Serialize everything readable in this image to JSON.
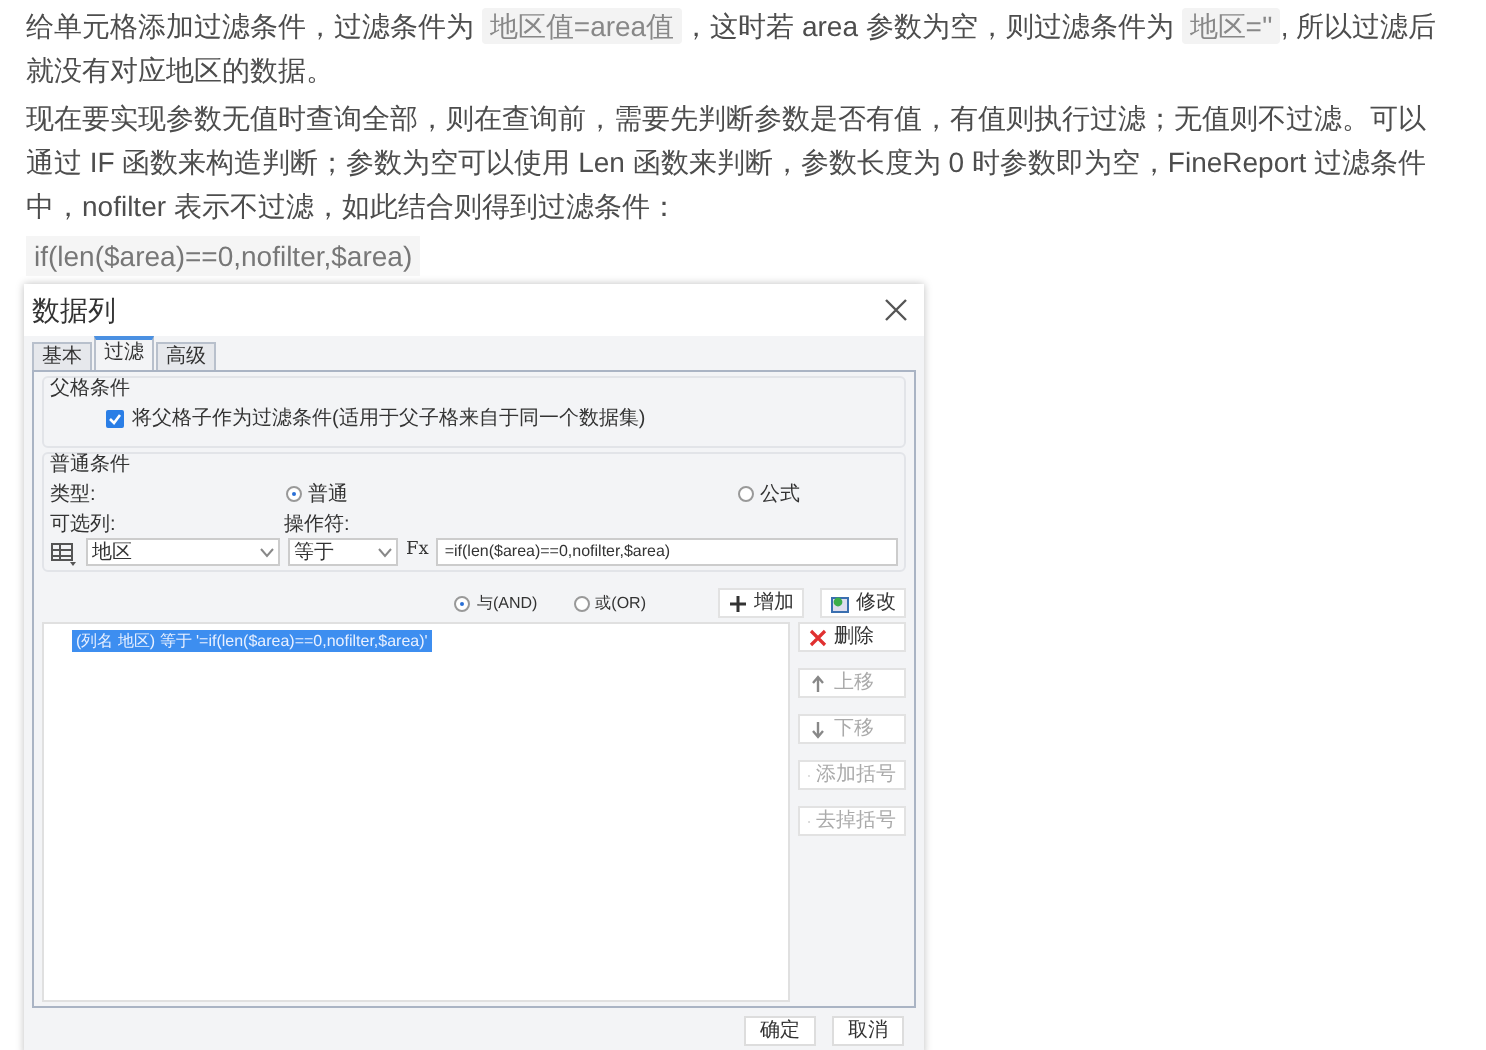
{
  "article": {
    "paragraphs": [
      {
        "segments": [
          {
            "kind": "text",
            "text": "给单元格添加过滤条件，过滤条件为 "
          },
          {
            "kind": "code",
            "text": "地区值=area值"
          },
          {
            "kind": "text",
            "text": "，这时若 area 参数为空，则过滤条件为 "
          },
          {
            "kind": "code",
            "text": "地区=''"
          },
          {
            "kind": "text",
            "text": ", 所以过滤后就没有对应地区的数据。"
          }
        ]
      },
      {
        "segments": [
          {
            "kind": "text",
            "text": "现在要实现参数无值时查询全部，则在查询前，需要先判断参数是否有值，有值则执行过滤；无值则不过滤。可以通过 IF 函数来构造判断；参数为空可以使用 Len 函数来判断，参数长度为 0 时参数即为空，FineReport 过滤条件中，nofilter 表示不过滤，如此结合则得到过滤条件："
          }
        ]
      }
    ],
    "code_block": "if(len($area)==0,nofilter,$area)"
  },
  "dialog": {
    "title": "数据列",
    "tabs": [
      {
        "label": "基本",
        "selected": false
      },
      {
        "label": "过滤",
        "selected": true
      },
      {
        "label": "高级",
        "selected": false
      }
    ],
    "parent_group": {
      "title": "父格条件",
      "checkbox": {
        "label": "将父格子作为过滤条件(适用于父子格来自于同一个数据集)",
        "checked": true
      }
    },
    "normal_group": {
      "title": "普通条件",
      "type_label": "类型:",
      "type_options": [
        {
          "label": "普通",
          "selected": true
        },
        {
          "label": "公式",
          "selected": false
        }
      ],
      "column_label": "可选列:",
      "operator_label": "操作符:",
      "column_value": "地区",
      "operator_value": "等于",
      "formula_button": "Fx",
      "formula_value": "=if(len($area)==0,nofilter,$area)"
    },
    "logic_options": [
      {
        "label": "与(AND)",
        "selected": true
      },
      {
        "label": "或(OR)",
        "selected": false
      }
    ],
    "top_buttons": [
      {
        "kind": "add",
        "label": "增加"
      },
      {
        "kind": "edit",
        "label": "修改"
      }
    ],
    "conditions": [
      {
        "text": "(列名 地区) 等于 '=if(len($area)==0,nofilter,$area)'",
        "selected": true
      }
    ],
    "side_buttons": [
      {
        "kind": "delete",
        "label": "删除",
        "disabled": false
      },
      {
        "kind": "up",
        "label": "上移",
        "disabled": true
      },
      {
        "kind": "down",
        "label": "下移",
        "disabled": true
      },
      {
        "kind": "add-paren",
        "label": "添加括号",
        "disabled": true
      },
      {
        "kind": "remove-paren",
        "label": "去掉括号",
        "disabled": true
      }
    ],
    "footer_buttons": [
      {
        "label": "确定"
      },
      {
        "label": "取消"
      }
    ]
  }
}
